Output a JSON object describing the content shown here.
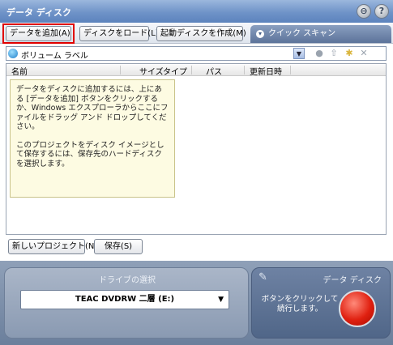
{
  "window": {
    "title": "データ ディスク"
  },
  "toolbar": {
    "add_data": "データを追加(A)",
    "load_disc": "ディスクをロード(L)",
    "create_boot": "起動ディスクを作成(M)",
    "quick_scan": "クイック スキャン"
  },
  "address": {
    "label": "ボリューム ラベル"
  },
  "list": {
    "columns": [
      "名前",
      "サイズ",
      "タイプ",
      "パス",
      "更新日時"
    ]
  },
  "tip": {
    "para1": "データをディスクに追加するには、上にある [データを追加] ボタンをクリックするか、Windows エクスプローラからここにファイルをドラッグ アンド ドロップしてください。",
    "para2": "このプロジェクトをディスク イメージとして保存するには、保存先のハードディスクを選択します。"
  },
  "bottom": {
    "new_project": "新しいプロジェクト(N)",
    "save": "保存(S)"
  },
  "drive": {
    "section_label": "ドライブの選択",
    "selected": "TEAC DVDRW 二層 (E:)"
  },
  "burn": {
    "section_label": "データ ディスク",
    "hint": "ボタンをクリックして続行します。"
  }
}
